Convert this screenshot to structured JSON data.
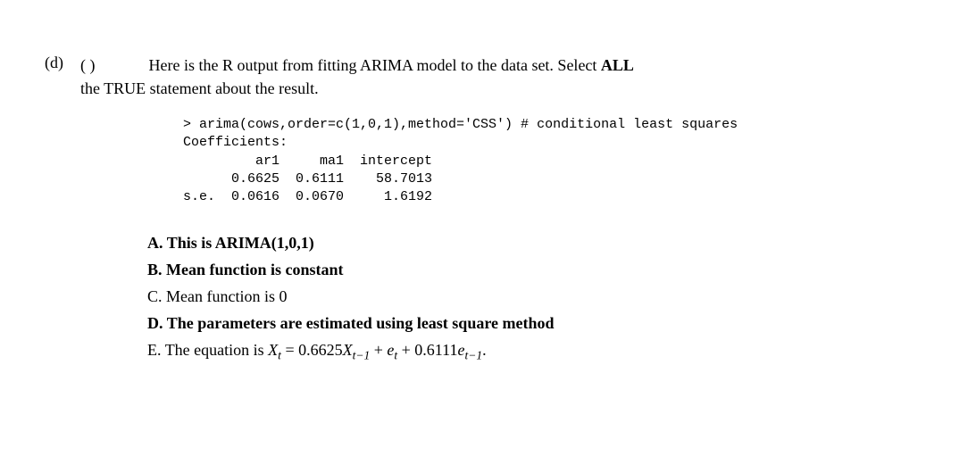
{
  "question": {
    "label": "(d)",
    "points_text": "(      )",
    "intro_1": "Here is the R output from fitting ARIMA model to the data set. Select ",
    "intro_all": "ALL",
    "intro_2": "the TRUE statement about the result."
  },
  "code": {
    "line1": "> arima(cows,order=c(1,0,1),method='CSS') # conditional least squares",
    "line2": "Coefficients:",
    "line3": "         ar1     ma1  intercept",
    "line4": "      0.6625  0.6111    58.7013",
    "line5": "s.e.  0.0616  0.0670     1.6192"
  },
  "choices": {
    "A": {
      "label": "A.",
      "text": "This is ARIMA(1,0,1)",
      "bold": true
    },
    "B": {
      "label": "B.",
      "text": "Mean function is constant",
      "bold": true
    },
    "C": {
      "label": "C.",
      "text": "Mean function is 0",
      "bold": false
    },
    "D": {
      "label": "D.",
      "text": "The parameters are estimated using least square method",
      "bold": true
    },
    "E": {
      "label": "E.",
      "prefix": "The equation is ",
      "var_X": "X",
      "sub_t": "t",
      "eq": " = 0.6625",
      "sub_tm1": "t−1",
      "plus1": " + ",
      "var_e": "e",
      "plus2": " + 0.6111",
      "period": ".",
      "bold": false
    }
  }
}
